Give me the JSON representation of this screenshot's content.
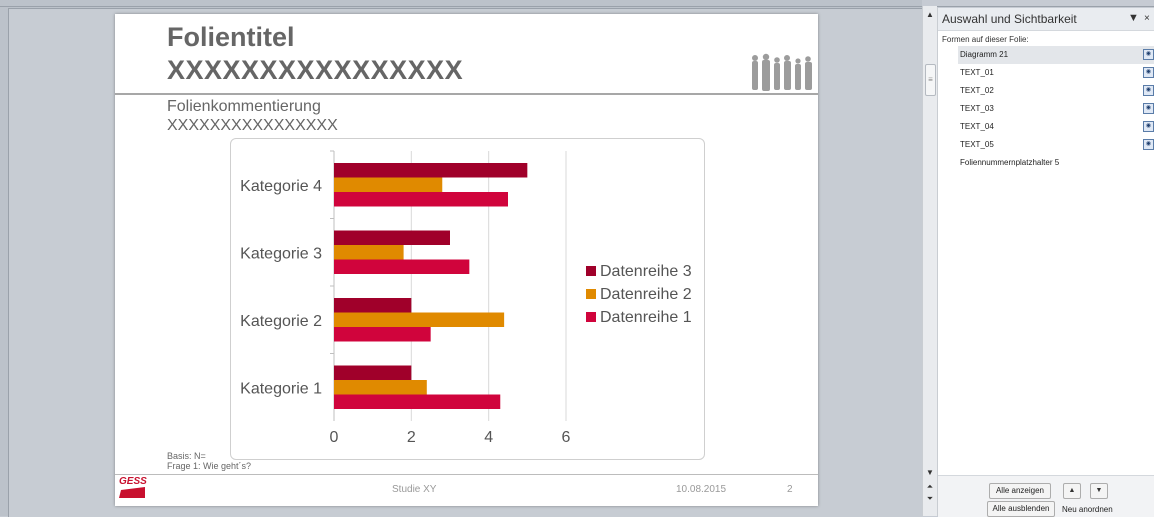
{
  "slide": {
    "title_line1": "Folientitel",
    "title_line2": "XXXXXXXXXXXXXXXX",
    "comment_line1": "Folienkommentierung",
    "comment_line2": "XXXXXXXXXXXXXXXX",
    "basis": "Basis: N=",
    "frage": "Frage 1: Wie geht´s?",
    "logo_text": "GESS",
    "footer_study": "Studie XY",
    "footer_date": "10.08.2015",
    "footer_page": "2"
  },
  "chart_data": {
    "type": "bar",
    "orientation": "horizontal",
    "categories": [
      "Kategorie 1",
      "Kategorie 2",
      "Kategorie 3",
      "Kategorie 4"
    ],
    "series": [
      {
        "name": "Datenreihe 1",
        "color": "#d0043c",
        "values": [
          4.3,
          2.5,
          3.5,
          4.5
        ]
      },
      {
        "name": "Datenreihe 2",
        "color": "#e08a00",
        "values": [
          2.4,
          4.4,
          1.8,
          2.8
        ]
      },
      {
        "name": "Datenreihe 3",
        "color": "#a0002a",
        "values": [
          2,
          2,
          3,
          5
        ]
      }
    ],
    "xlim": [
      0,
      6
    ],
    "xticks": [
      "0",
      "2",
      "4",
      "6"
    ],
    "grid": true,
    "legend_position": "right"
  },
  "pane": {
    "title": "Auswahl und Sichtbarkeit",
    "subtitle": "Formen auf dieser Folie:",
    "items": [
      {
        "label": "Diagramm 21",
        "selected": true
      },
      {
        "label": "TEXT_01"
      },
      {
        "label": "TEXT_02"
      },
      {
        "label": "TEXT_03"
      },
      {
        "label": "TEXT_04"
      },
      {
        "label": "TEXT_05"
      },
      {
        "label": "Foliennummernplatzhalter 5"
      }
    ],
    "show_all": "Alle anzeigen",
    "hide_all": "Alle ausblenden",
    "reorder": "Neu anordnen"
  }
}
